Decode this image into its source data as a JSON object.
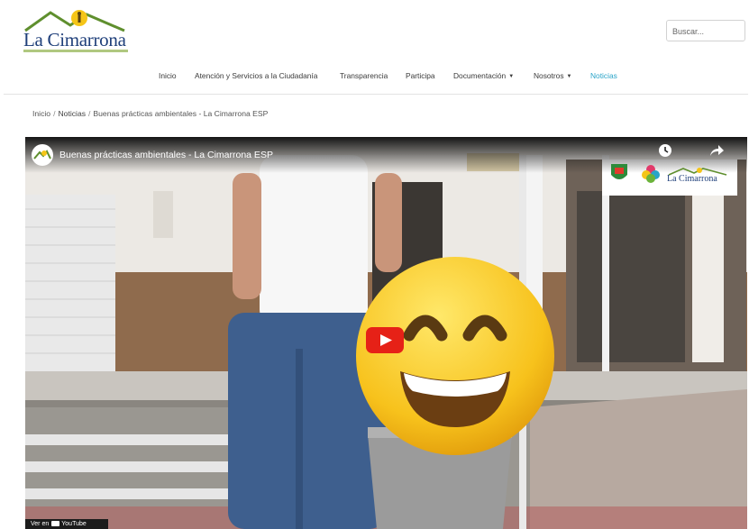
{
  "brand": {
    "name": "La Cimarrona"
  },
  "search": {
    "placeholder": "Buscar..."
  },
  "nav": {
    "items": [
      {
        "label": "Inicio",
        "active": false
      },
      {
        "label": "Atención y Servicios a la Ciudadanía",
        "active": false
      },
      {
        "label": "Transparencia",
        "active": false
      },
      {
        "label": "Participa",
        "active": false
      },
      {
        "label": "Documentación",
        "active": false,
        "dropdown": true
      },
      {
        "label": "Nosotros",
        "active": false,
        "dropdown": true
      },
      {
        "label": "Noticias",
        "active": true
      }
    ]
  },
  "breadcrumb": {
    "home": "Inicio",
    "section": "Noticias",
    "current": "Buenas prácticas ambientales - La Cimarrona ESP"
  },
  "video": {
    "title": "Buenas prácticas ambientales - La Cimarrona ESP",
    "watch_on": "Ver en",
    "platform": "YouTube",
    "overlay_brand": "La Cimarrona"
  },
  "colors": {
    "brand_blue": "#1f3f7a",
    "nav_active": "#2aa4c8",
    "youtube_red": "#e62117",
    "emoji_yellow": "#f7c21c"
  }
}
